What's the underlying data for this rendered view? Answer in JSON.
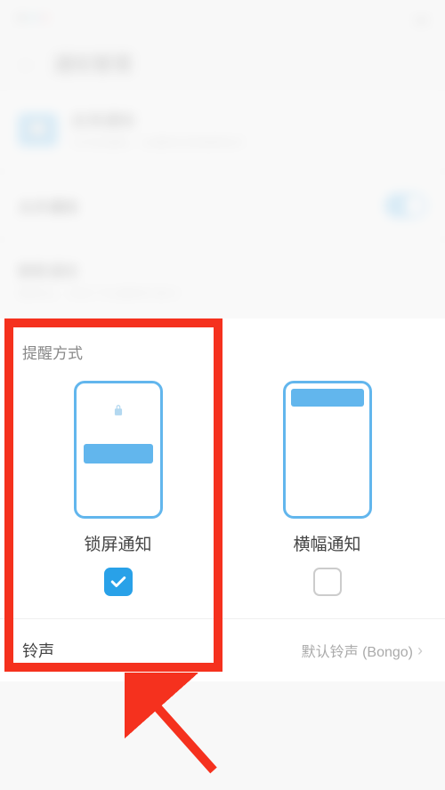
{
  "header": {
    "title": "通知管理"
  },
  "app": {
    "name": "应用通知",
    "desc": "已开启通知，在通知栏和锁屏显示"
  },
  "toggle": {
    "label": "允许通知"
  },
  "desc_row": {
    "title": "静默通知",
    "subtitle": "静默后，仅在下拉通知栏显示"
  },
  "reminder": {
    "section_title": "提醒方式",
    "options": [
      {
        "label": "锁屏通知",
        "checked": true
      },
      {
        "label": "横幅通知",
        "checked": false
      }
    ]
  },
  "ringtone": {
    "label": "铃声",
    "value": "默认铃声 (Bongo)"
  }
}
